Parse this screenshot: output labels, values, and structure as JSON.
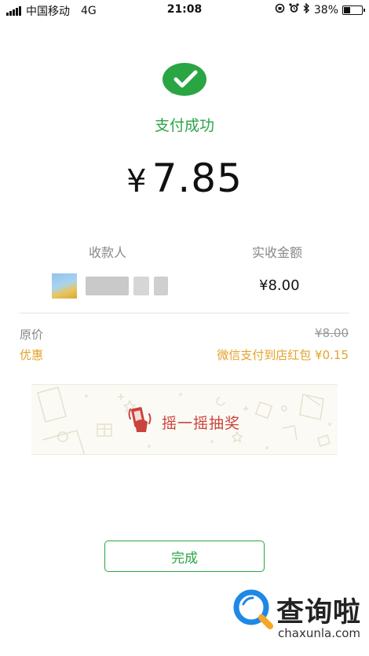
{
  "status_bar": {
    "carrier": "中国移动",
    "network": "4G",
    "time": "21:08",
    "icons": [
      "rotation-lock-icon",
      "alarm-icon",
      "bluetooth-icon",
      "battery-icon"
    ],
    "battery": "38%",
    "battery_level": 0.38
  },
  "payment": {
    "status": "支付成功",
    "currency_symbol": "¥",
    "amount": "7.85",
    "brand_color": "#2aa544"
  },
  "details": {
    "payee_header": "收款人",
    "received_header": "实收金额",
    "received_value": "¥8.00",
    "original_price_label": "原价",
    "original_price_value": "¥8.00",
    "discount_label": "优惠",
    "discount_value": "微信支付到店红包 ¥0.15",
    "discount_color": "#e3a32a"
  },
  "lottery": {
    "label": "摇一摇抽奖",
    "accent_color": "#c9443c"
  },
  "actions": {
    "done_label": "完成"
  },
  "watermark": {
    "name": "查询啦",
    "url": "chaxunla.com"
  }
}
